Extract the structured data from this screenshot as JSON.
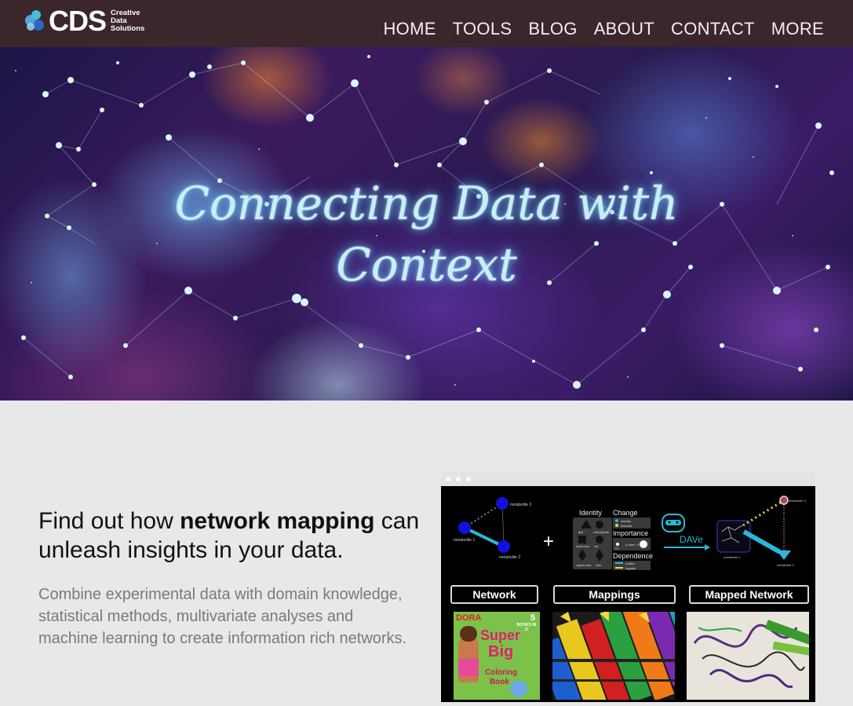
{
  "header": {
    "logo_text": "CDS",
    "logo_sub": [
      "Creative",
      "Data",
      "Solutions"
    ],
    "nav": [
      "HOME",
      "TOOLS",
      "BLOG",
      "ABOUT",
      "CONTACT",
      "MORE"
    ]
  },
  "hero": {
    "title_line1": "Connecting Data with",
    "title_line2": "Context"
  },
  "feature": {
    "headline_pre": "Find out how ",
    "headline_bold": "network mapping",
    "headline_post": " can unleash insights in your data.",
    "description": "Combine experimental data with domain knowledge, statistical methods, multivariate analyses and machine learning to create information rich networks."
  },
  "figure": {
    "node_labels": [
      "metabolite 1",
      "metabolite 2",
      "metabolite 3"
    ],
    "plus": "+",
    "legend": {
      "identity": "Identity",
      "change": "Change",
      "increase": "increase",
      "decrease": "decrease",
      "importance": "Importance",
      "dependence": "Dependence",
      "positive": "positive",
      "negative": "negative",
      "identity_items": [
        "lipid",
        "carbohydrate",
        "amino acid",
        "xxx",
        "organic acid",
        "misc."
      ],
      "p_value": "p-value < 0.05",
      "fc": "FC"
    },
    "dave_label": "DAVe",
    "labels": [
      "Network",
      "Mappings",
      "Mapped Network"
    ],
    "book": {
      "brand": "DORA",
      "count": "5",
      "count_label": "BOOKS IN 1!",
      "line1": "Super",
      "line2": "Big",
      "line3": "Coloring",
      "line4": "Book"
    }
  },
  "colors": {
    "header_bg": "#3a262b",
    "accent_cyan": "#27b9d6",
    "node_blue": "#1111dd"
  }
}
